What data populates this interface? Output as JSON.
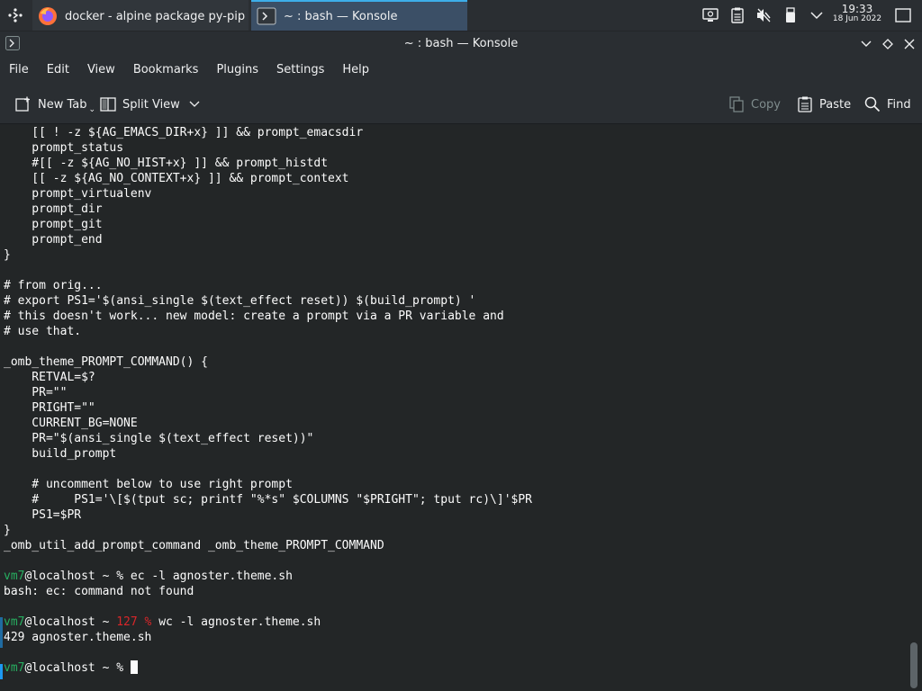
{
  "taskbar": {
    "tasks": [
      {
        "label": "docker - alpine package py-pip m...",
        "icon": "firefox-icon"
      },
      {
        "label": "~ : bash — Konsole",
        "icon": "konsole-icon"
      }
    ],
    "tray_icons": [
      "screen-icon",
      "clipboard-icon",
      "volume-muted-icon",
      "usb-device-icon",
      "chevron-down-icon"
    ],
    "clock_time": "19:33",
    "clock_date": "18 Jun 2022"
  },
  "window": {
    "title": "~ : bash — Konsole"
  },
  "menubar": {
    "items": [
      "File",
      "Edit",
      "View",
      "Bookmarks",
      "Plugins",
      "Settings",
      "Help"
    ]
  },
  "toolbar": {
    "new_tab": "New Tab",
    "split_view": "Split View",
    "copy": "Copy",
    "paste": "Paste",
    "find": "Find"
  },
  "terminal": {
    "lines": [
      "    [[ ! -z ${AG_EMACS_DIR+x} ]] && prompt_emacsdir",
      "    prompt_status",
      "    #[[ -z ${AG_NO_HIST+x} ]] && prompt_histdt",
      "    [[ -z ${AG_NO_CONTEXT+x} ]] && prompt_context",
      "    prompt_virtualenv",
      "    prompt_dir",
      "    prompt_git",
      "    prompt_end",
      "}",
      "",
      "# from orig...",
      "# export PS1='$(ansi_single $(text_effect reset)) $(build_prompt) '",
      "# this doesn't work... new model: create a prompt via a PR variable and",
      "# use that.",
      "",
      "_omb_theme_PROMPT_COMMAND() {",
      "    RETVAL=$?",
      "    PR=\"\"",
      "    PRIGHT=\"\"",
      "    CURRENT_BG=NONE",
      "    PR=\"$(ansi_single $(text_effect reset))\"",
      "    build_prompt",
      "",
      "    # uncomment below to use right prompt",
      "    #     PS1='\\[$(tput sc; printf \"%*s\" $COLUMNS \"$PRIGHT\"; tput rc)\\]'$PR",
      "    PS1=$PR",
      "}",
      "_omb_util_add_prompt_command _omb_theme_PROMPT_COMMAND",
      ""
    ],
    "session": {
      "user": "vm7",
      "host_path": "@localhost ~ ",
      "prompt_char": "%",
      "cmd1": " ec -l agnoster.theme.sh",
      "out1": "bash: ec: command not found",
      "exit_code": "127 %",
      "cmd2": " wc -l agnoster.theme.sh",
      "out2": "429 agnoster.theme.sh",
      "cursor_prompt": "% "
    }
  },
  "colors": {
    "prompt_user": "#27ae60",
    "error_code": "#d8262a",
    "active_task": "#3b4f66",
    "accent": "#3daee9"
  }
}
